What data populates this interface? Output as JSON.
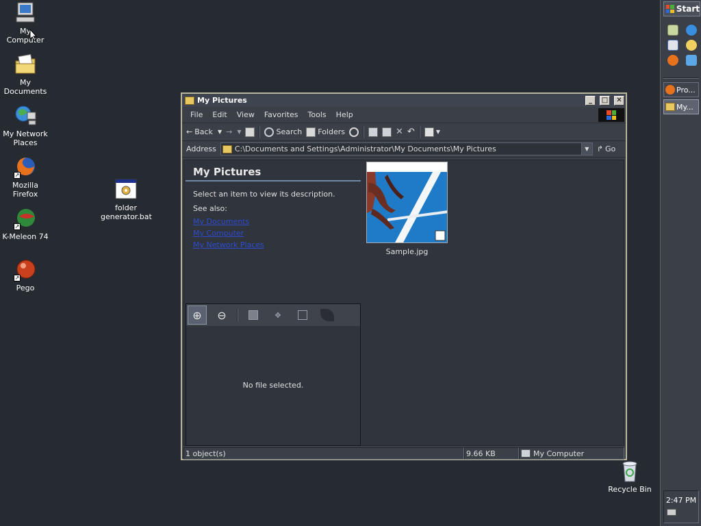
{
  "desktop": {
    "icons": [
      {
        "label": "My Computer"
      },
      {
        "label": "My Documents"
      },
      {
        "label": "My Network Places"
      },
      {
        "label": "Mozilla Firefox"
      },
      {
        "label": "K-Meleon 74"
      },
      {
        "label": "Pego"
      },
      {
        "label": "folder generator.bat"
      },
      {
        "label": "Recycle Bin"
      }
    ]
  },
  "taskbar": {
    "start_label": "Start",
    "tasks": [
      {
        "label": "Pro..."
      },
      {
        "label": "My..."
      }
    ],
    "clock": "2:47 PM"
  },
  "window": {
    "title": "My Pictures",
    "menu": [
      "File",
      "Edit",
      "View",
      "Favorites",
      "Tools",
      "Help"
    ],
    "toolbar": {
      "back": "Back",
      "search": "Search",
      "folders": "Folders"
    },
    "address_label": "Address",
    "address_value": "C:\\Documents and Settings\\Administrator\\My Documents\\My Pictures",
    "go_label": "Go",
    "taskpane": {
      "title": "My Pictures",
      "description": "Select an item to view its description.",
      "see_also": "See also:",
      "links": [
        "My Documents",
        "My Computer",
        "My Network Places"
      ]
    },
    "preview": {
      "message": "No file selected."
    },
    "file": {
      "name": "Sample.jpg"
    },
    "status": {
      "objects": "1 object(s)",
      "size": "9.66 KB",
      "location": "My Computer"
    }
  },
  "colors": {
    "desktop": "#262a31",
    "link": "#2e4bd0",
    "accent": "#6f86a8"
  }
}
